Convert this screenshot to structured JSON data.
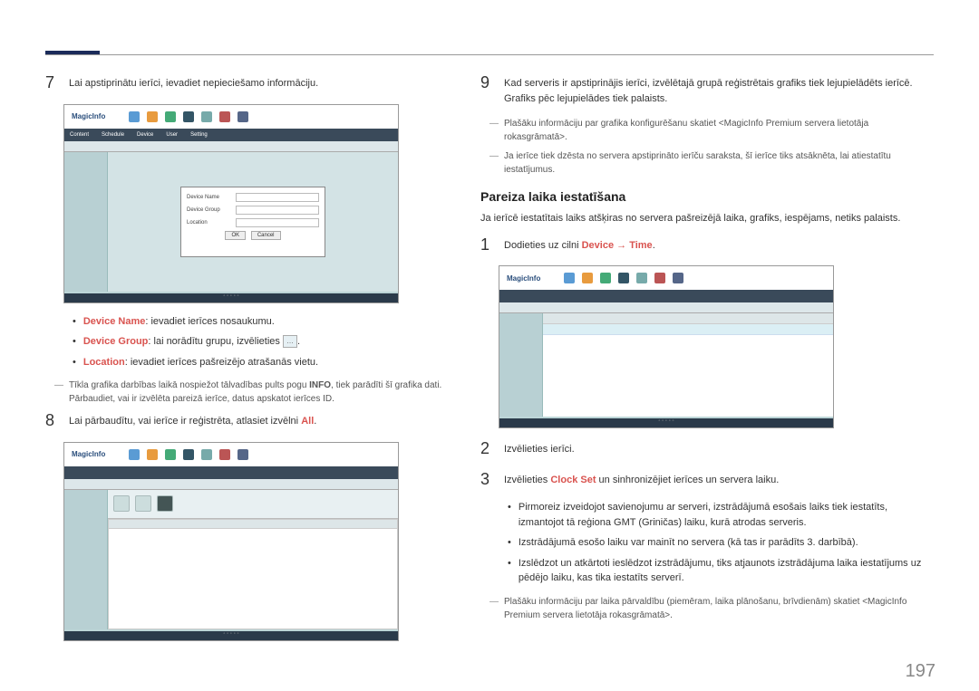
{
  "header": {},
  "left": {
    "step7": {
      "num": "7",
      "text": "Lai apstiprinātu ierīci, ievadiet nepieciešamo informāciju."
    },
    "screenshot1": {
      "logo": "MagicInfo",
      "tabs": [
        "Content",
        "Schedule",
        "Device",
        "User",
        "Setting"
      ],
      "dialog": {
        "row1_label": "Device Name",
        "row2_label": "Device Group",
        "row3_label": "Location",
        "btn_ok": "OK",
        "btn_cancel": "Cancel"
      }
    },
    "bullets": [
      {
        "label": "Device Name",
        "text": ": ievadiet ierīces nosaukumu."
      },
      {
        "label": "Device Group",
        "text": ": lai norādītu grupu, izvēlieties",
        "has_icon": true,
        "trailing": "."
      },
      {
        "label": "Location",
        "text": ": ievadiet ierīces pašreizējo atrašanās vietu."
      }
    ],
    "note1": "Tīkla grafika darbības laikā nospiežot tālvadības pults pogu INFO, tiek parādīti šī grafika dati. Pārbaudiet, vai ir izvēlēta pareizā ierīce, datus apskatot ierīces ID.",
    "note1_bold": "INFO",
    "step8": {
      "num": "8",
      "text_before": "Lai pārbaudītu, vai ierīce ir reģistrēta, atlasiet izvēlni ",
      "text_bold": "All",
      "text_after": "."
    },
    "screenshot2": {
      "logo": "MagicInfo"
    }
  },
  "right": {
    "step9": {
      "num": "9",
      "text": "Kad serveris ir apstiprinājis ierīci, izvēlētajā grupā reģistrētais grafiks tiek lejupielādēts ierīcē. Grafiks pēc lejupielādes tiek palaists."
    },
    "note_a": "Plašāku informāciju par grafika konfigurēšanu skatiet <MagicInfo Premium servera lietotāja rokasgrāmatā>.",
    "note_b": "Ja ierīce tiek dzēsta no servera apstiprināto ierīču saraksta, šī ierīce tiks atsāknēta, lai atiestatītu iestatījumus.",
    "section_title": "Pareiza laika iestatīšana",
    "section_desc": "Ja ierīcē iestatītais laiks atšķiras no servera pašreizējā laika, grafiks, iespējams, netiks palaists.",
    "step1": {
      "num": "1",
      "text_before": "Dodieties uz cilni ",
      "text_bold1": "Device",
      "arrow": " → ",
      "text_bold2": "Time",
      "text_after": "."
    },
    "screenshot3": {
      "logo": "MagicInfo"
    },
    "step2": {
      "num": "2",
      "text": "Izvēlieties ierīci."
    },
    "step3": {
      "num": "3",
      "text_before": "Izvēlieties ",
      "text_bold": "Clock Set",
      "text_after": " un sinhronizējiet ierīces un servera laiku."
    },
    "bullets2": [
      "Pirmoreiz izveidojot savienojumu ar serveri, izstrādājumā esošais laiks tiek iestatīts, izmantojot tā reģiona GMT (Griničas) laiku, kurā atrodas serveris.",
      "Izstrādājumā esošo laiku var mainīt no servera (kā tas ir parādīts 3. darbībā).",
      "Izslēdzot un atkārtoti ieslēdzot izstrādājumu, tiks atjaunots izstrādājuma laika iestatījums uz pēdējo laiku, kas tika iestatīts serverī."
    ],
    "note_c": "Plašāku informāciju par laika pārvaldību (piemēram, laika plānošanu, brīvdienām) skatiet <MagicInfo Premium servera lietotāja rokasgrāmatā>."
  },
  "page_number": "197"
}
